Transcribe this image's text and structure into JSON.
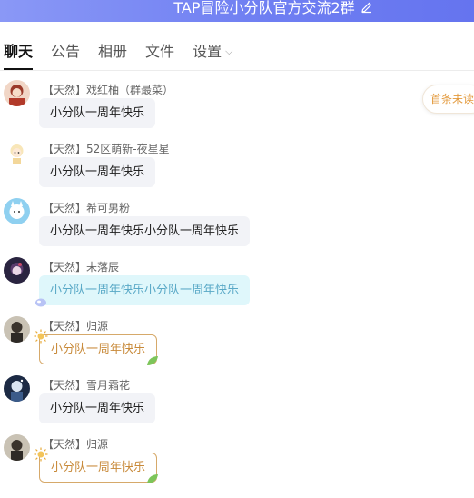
{
  "header": {
    "title": "TAP冒险小分队官方交流2群",
    "edit_icon": "edit-icon"
  },
  "tabs": [
    {
      "label": "聊天"
    },
    {
      "label": "公告"
    },
    {
      "label": "相册"
    },
    {
      "label": "文件"
    },
    {
      "label": "设置"
    }
  ],
  "unread_pill": {
    "label": "首条未读消"
  },
  "colors": {
    "header_gradient_start": "#8a98f6",
    "header_gradient_end": "#6574ef",
    "unread_text": "#e39a3d",
    "gold_bubble": "#c88a3a",
    "cyan_bubble_text": "#5aa9c7"
  },
  "messages": [
    {
      "sender": "【天然】戏红柚（群最菜）",
      "text": "小分队一周年快乐"
    },
    {
      "sender": "【天然】52区萌新-夜星星",
      "text": "小分队一周年快乐"
    },
    {
      "sender": "【天然】希可男粉",
      "text": "小分队一周年快乐小分队一周年快乐"
    },
    {
      "sender": "【天然】未落辰",
      "text": "小分队一周年快乐小分队一周年快乐"
    },
    {
      "sender": "【天然】归源",
      "text": "小分队一周年快乐"
    },
    {
      "sender": "【天然】雪月霜花",
      "text": "小分队一周年快乐"
    },
    {
      "sender": "【天然】归源",
      "text": "小分队一周年快乐"
    }
  ]
}
